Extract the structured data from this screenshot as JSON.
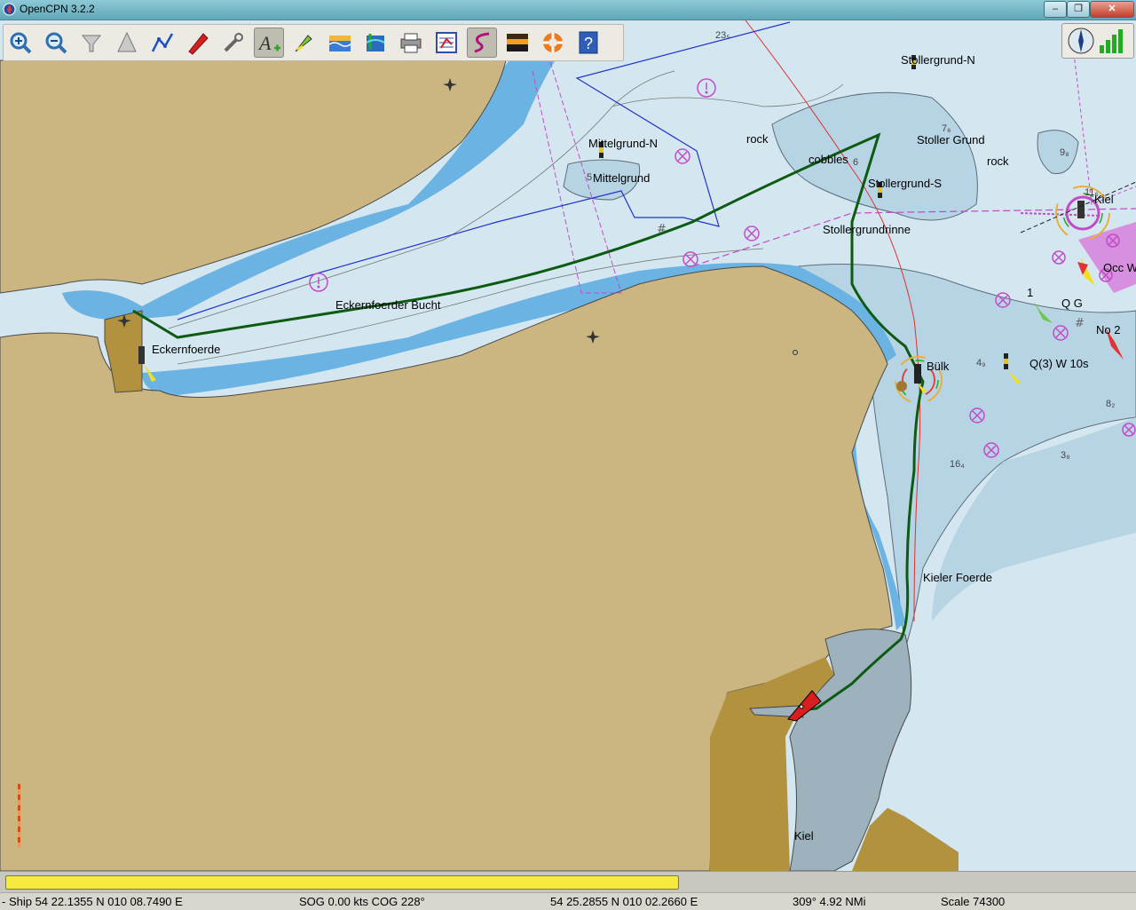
{
  "window": {
    "title": "OpenCPN 3.2.2",
    "close_label": "✕",
    "min_label": "–",
    "max_label": "❐"
  },
  "toolbar": {
    "buttons": [
      {
        "name": "zoom-in",
        "icon": "zoom-in-icon"
      },
      {
        "name": "zoom-out",
        "icon": "zoom-out-icon"
      },
      {
        "name": "scale-in",
        "icon": "funnel-icon"
      },
      {
        "name": "scale-out",
        "icon": "cone-icon"
      },
      {
        "name": "route",
        "icon": "route-icon"
      },
      {
        "name": "auto-follow",
        "icon": "boat-icon"
      },
      {
        "name": "options",
        "icon": "wrench-icon"
      },
      {
        "name": "text",
        "icon": "text-icon",
        "active": true
      },
      {
        "name": "current-tide",
        "icon": "current-icon"
      },
      {
        "name": "tides",
        "icon": "tide-icon"
      },
      {
        "name": "quilting",
        "icon": "layers-icon"
      },
      {
        "name": "print",
        "icon": "printer-icon"
      },
      {
        "name": "route-manager",
        "icon": "route-manager-icon"
      },
      {
        "name": "track",
        "icon": "track-icon",
        "active": true
      },
      {
        "name": "color-scheme",
        "icon": "sunset-icon"
      },
      {
        "name": "mob",
        "icon": "lifebuoy-icon"
      },
      {
        "name": "help",
        "icon": "help-icon"
      }
    ]
  },
  "chart": {
    "place_labels": {
      "stollergrund_n": "Stollergrund-N",
      "stoller_grund": "Stoller Grund",
      "rock1": "rock",
      "rock2": "rock",
      "mittelgrund_n": "Mittelgrund-N",
      "mittelgrund": "Mittelgrund",
      "cobbles": "cobbles",
      "stollergrund_s": "Stollergrund-S",
      "stollergrundrinne": "Stollergrundrinne",
      "eckernfoerder_bucht": "Eckernfoerder Bucht",
      "eckernfoerde": "Eckernfoerde",
      "buelk": "Bülk",
      "kieler_foerde": "Kieler Foerde",
      "kiel": "Kiel",
      "kiel_light": "Kiel",
      "occ": "Occ W",
      "q_g": "Q G",
      "q3": "Q(3) W 10s",
      "no2": "No 2",
      "one": "1"
    },
    "soundings": {
      "s23": "23₅",
      "s76": "7₆",
      "s98": "9₈",
      "s116": "11₆",
      "s5": "5",
      "s6": "6",
      "s49": "4₉",
      "s82": "8₂",
      "s38": "3₈",
      "s164": "16₄"
    }
  },
  "progress": {
    "value": 0.595
  },
  "status": {
    "ship": "- Ship 54 22.1355 N   010 08.7490 E",
    "sog_cog": "SOG 0.00 kts   COG 228°",
    "cursor": "54 25.2855 N   010 02.2660 E",
    "bearing": "309°   4.92 NMi",
    "scale": "Scale 74300"
  },
  "colors": {
    "land": "#cbb682",
    "shallow": "#6ab3e2",
    "deep": "#d4e7f0",
    "track": "#0d5a12",
    "route": "#2233cc"
  }
}
